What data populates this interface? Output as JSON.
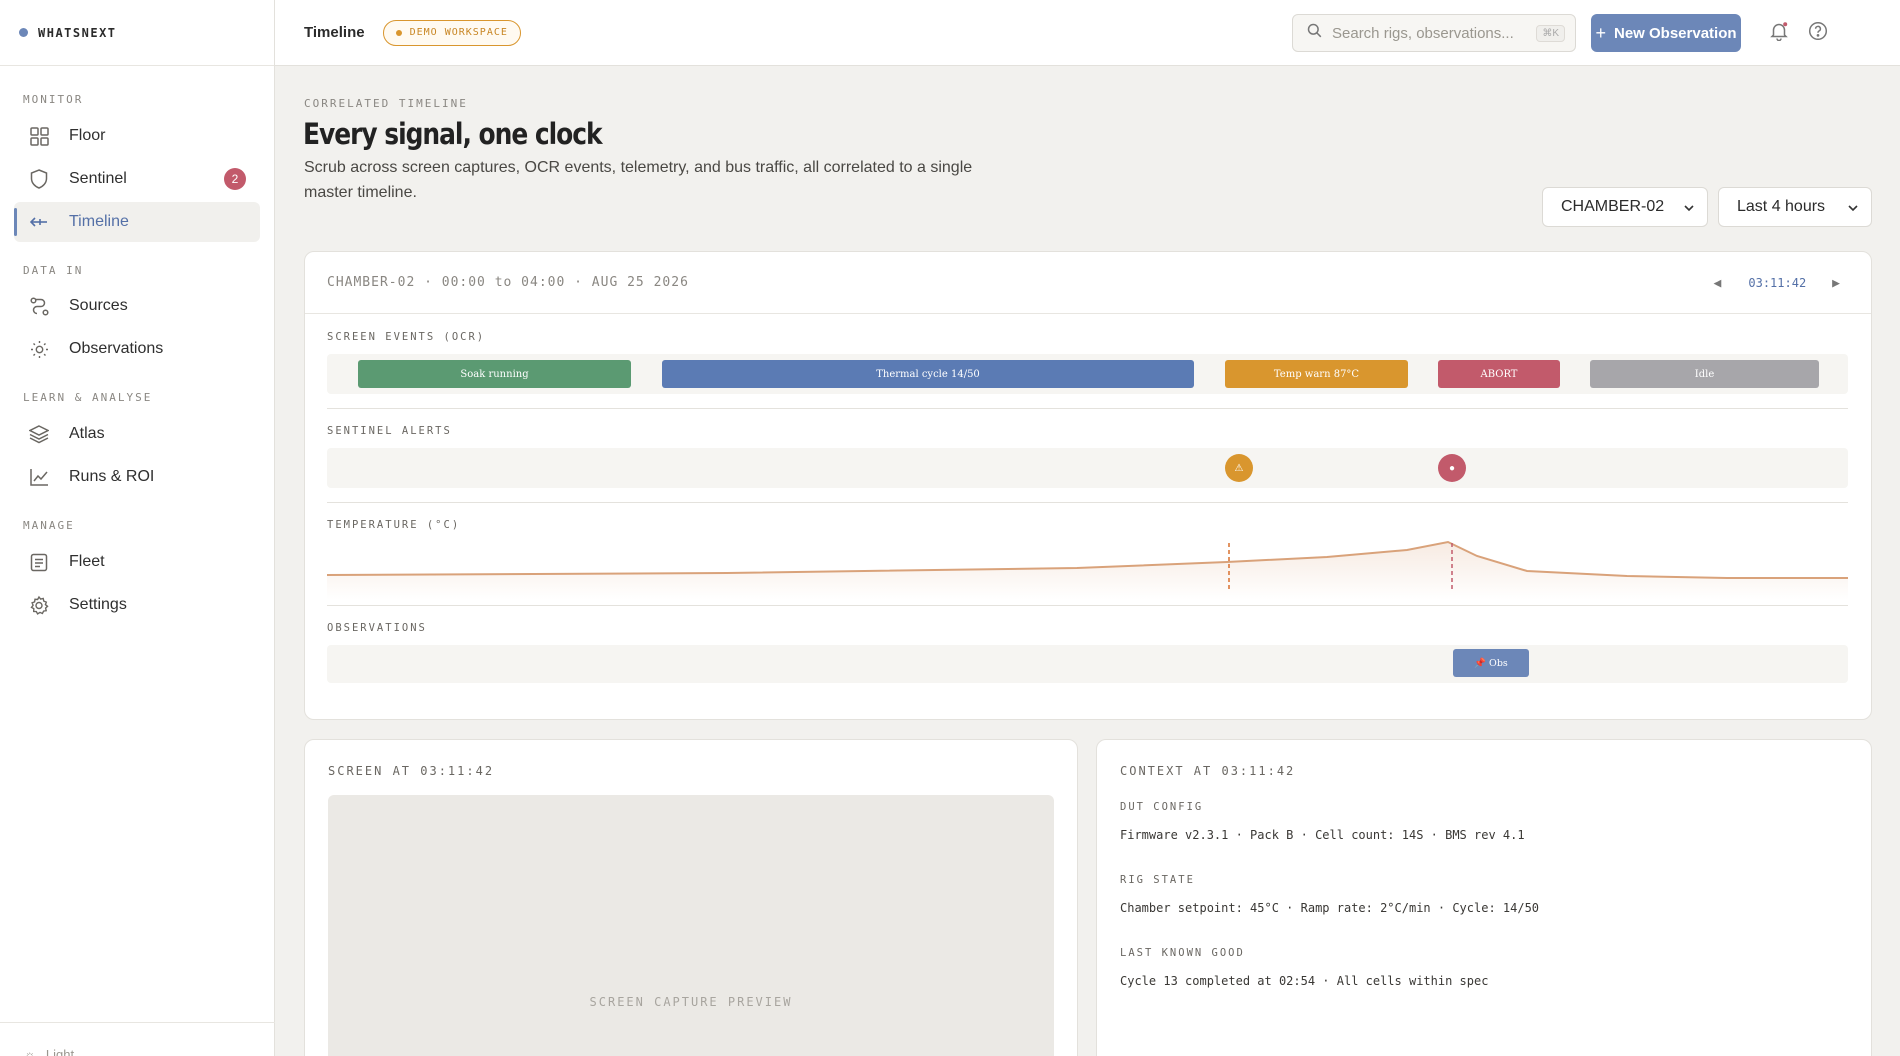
{
  "app": {
    "name": "WHATSNEXT"
  },
  "sidebar": {
    "sections": [
      {
        "label": "MONITOR"
      },
      {
        "label": "DATA IN"
      },
      {
        "label": "LEARN & ANALYSE"
      },
      {
        "label": "MANAGE"
      }
    ],
    "items": [
      {
        "label": "Floor",
        "icon": "grid-icon"
      },
      {
        "label": "Sentinel",
        "icon": "shield-icon",
        "badge": "2"
      },
      {
        "label": "Timeline",
        "icon": "timeline-icon",
        "active": true
      },
      {
        "label": "Sources",
        "icon": "route-icon"
      },
      {
        "label": "Observations",
        "icon": "sun-icon"
      },
      {
        "label": "Atlas",
        "icon": "layers-icon"
      },
      {
        "label": "Runs & ROI",
        "icon": "chart-line-icon"
      },
      {
        "label": "Fleet",
        "icon": "list-icon"
      },
      {
        "label": "Settings",
        "icon": "gear-icon"
      }
    ],
    "footer_label": "Light"
  },
  "topbar": {
    "title": "Timeline",
    "workspace_badge": "DEMO WORKSPACE",
    "search_placeholder": "Search rigs, observations...",
    "search_shortcut": "⌘K",
    "new_button": "New Observation"
  },
  "page": {
    "eyebrow": "CORRELATED TIMELINE",
    "title": "Every signal, one clock",
    "subtitle": "Scrub across screen captures, OCR events, telemetry, and bus traffic, all correlated to a single master timeline.",
    "rig_select": "CHAMBER-02",
    "range_select": "Last 4 hours"
  },
  "timeline": {
    "header": "CHAMBER-02 · 00:00 to 04:00 · AUG 25 2026",
    "current_time": "03:11:42",
    "lanes": {
      "screen_events": "SCREEN EVENTS (OCR)",
      "sentinel_alerts": "SENTINEL ALERTS",
      "temperature": "TEMPERATURE (°C)",
      "observations": "OBSERVATIONS"
    },
    "events": [
      {
        "label": "Soak running",
        "color": "#5b9a72"
      },
      {
        "label": "Thermal cycle 14/50",
        "color": "#5b7bb4"
      },
      {
        "label": "Temp warn 87°C",
        "color": "#d9962e"
      },
      {
        "label": "ABORT",
        "color": "#c25a6b"
      },
      {
        "label": "Idle",
        "color": "#a7a6aa"
      }
    ],
    "alerts": [
      {
        "glyph": "⚠",
        "color": "#d9962e"
      },
      {
        "glyph": "●",
        "color": "#c25a6b"
      }
    ],
    "observation_chip": "📌 Obs"
  },
  "screen_panel": {
    "title": "SCREEN AT 03:11:42",
    "preview_label": "SCREEN CAPTURE PREVIEW"
  },
  "context_panel": {
    "title": "CONTEXT AT 03:11:42",
    "dut_label": "DUT CONFIG",
    "dut_value": "Firmware v2.3.1 · Pack B · Cell count: 14S · BMS rev 4.1",
    "rig_label": "RIG STATE",
    "rig_value": "Chamber setpoint: 45°C · Ramp rate: 2°C/min · Cycle: 14/50",
    "lkg_label": "LAST KNOWN GOOD",
    "lkg_value": "Cycle 13 completed at 02:54 · All cells within spec"
  }
}
